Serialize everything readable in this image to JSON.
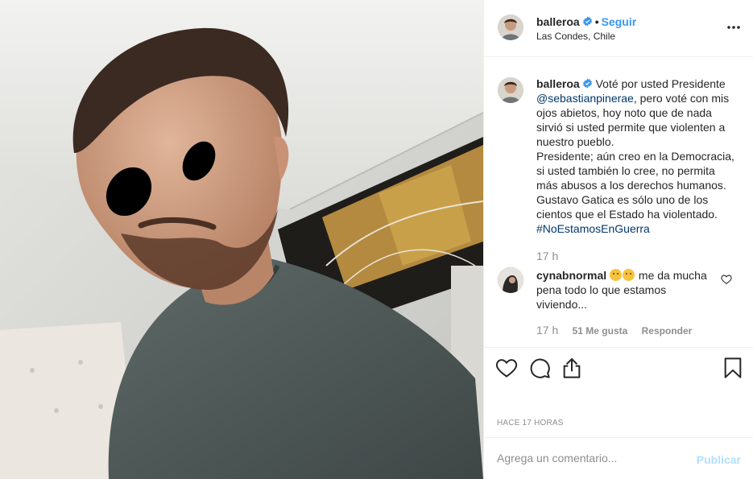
{
  "post": {
    "username": "balleroa",
    "follow_label": "Seguir",
    "separator": "•",
    "location": "Las Condes, Chile"
  },
  "caption": {
    "username": "balleroa",
    "text_before_mention": "Voté por usted Presidente",
    "mention": "@sebastianpinerae",
    "text_after_mention": ", pero voté con mis ojos abietos, hoy noto que de nada sirvió si usted permite que violenten a nuestro pueblo.",
    "paragraph_2": "Presidente; aún creo en la Democracia, si usted también lo cree, no permita más abusos a los derechos humanos. Gustavo Gatica es sólo uno de los cientos que el Estado ha violentado.",
    "hashtag": "#NoEstamosEnGuerra",
    "time": "17 h"
  },
  "comment": {
    "username": "cynabnormal",
    "text": "me da mucha pena todo lo que estamos viviendo...",
    "time": "17 h",
    "likes": "51 Me gusta",
    "reply_label": "Responder"
  },
  "footer": {
    "time_ago": "HACE 17 HORAS",
    "comment_placeholder": "Agrega un comentario...",
    "publish_label": "Publicar"
  },
  "colors": {
    "link_blue": "#3897f0",
    "text": "#262626",
    "muted": "#8e8e8e",
    "publish_disabled": "#b2dffc"
  },
  "icons": [
    "more-options-icon",
    "verified-badge-icon",
    "heart-icon",
    "comment-icon",
    "share-icon",
    "bookmark-icon",
    "like-comment-icon"
  ]
}
